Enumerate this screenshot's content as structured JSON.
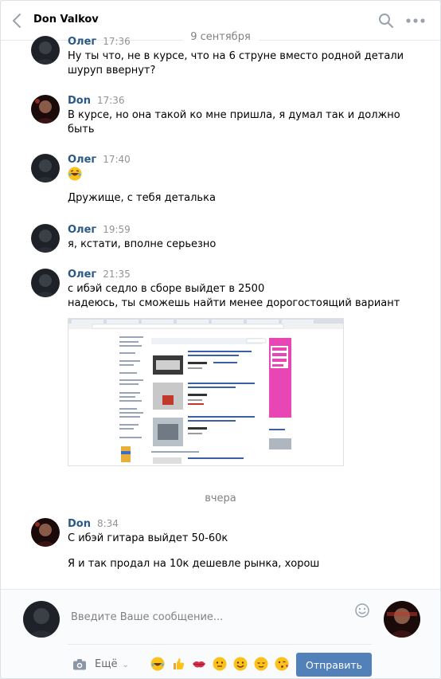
{
  "header": {
    "peer_name": "Don Valkov"
  },
  "separators": {
    "first": "9 сентября",
    "second": "вчера"
  },
  "messages": [
    {
      "author": "Олег",
      "time": "17:36",
      "lines": [
        "Ну ты что, не в курсе, что на 6 струне вместо родной детали",
        "шуруп ввернут?"
      ]
    },
    {
      "author": "Don",
      "time": "17:36",
      "lines": [
        "В курсе, но она такой ко мне пришла, я думал так и должно",
        "быть"
      ]
    },
    {
      "author": "Олег",
      "time": "17:40",
      "lines": [
        "Дружище, с тебя деталька"
      ]
    },
    {
      "author": "Олег",
      "time": "19:59",
      "lines": [
        "я, кстати, вполне серьезно"
      ]
    },
    {
      "author": "Олег",
      "time": "21:35",
      "lines": [
        "с ибэй седло в сборе выйдет в 2500",
        "надеюсь, ты сможешь найти менее дорогостоящий вариант"
      ]
    },
    {
      "author": "Don",
      "time": "8:34",
      "lines": [
        "С ибэй гитара выйдет 50-60к",
        "Я и так продал на 10к дешевле рынка, хорош"
      ]
    }
  ],
  "composer": {
    "placeholder": "Введите Ваше сообщение...",
    "more_label": "Ещё",
    "send_label": "Отправить"
  },
  "colors": {
    "accent": "#5181b8",
    "link": "#2a5885",
    "muted": "#939393"
  }
}
